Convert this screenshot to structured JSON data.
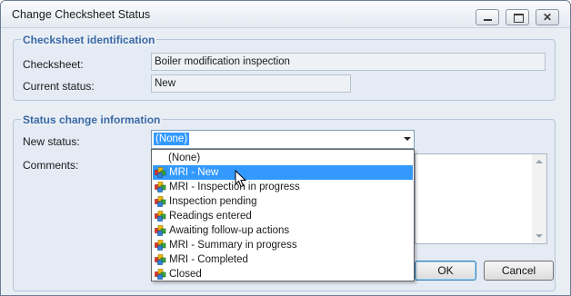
{
  "window": {
    "title": "Change Checksheet Status",
    "controls": {
      "minimize": "—",
      "maximize": "☐",
      "close": "✕"
    }
  },
  "identification": {
    "title": "Checksheet identification",
    "checksheet_label": "Checksheet:",
    "checksheet_value": "Boiler modification inspection",
    "status_label": "Current status:",
    "status_value": "New"
  },
  "change": {
    "title": "Status change information",
    "new_status_label": "New status:",
    "new_status_value": "(None)",
    "comments_label": "Comments:",
    "comments_value": ""
  },
  "dropdown": {
    "selected_index": 1,
    "options": [
      {
        "label": "(None)",
        "icon": "none"
      },
      {
        "label": "MRI - New",
        "icon": "status-cubes-icon"
      },
      {
        "label": "MRI - Inspection in progress",
        "icon": "status-cubes-icon"
      },
      {
        "label": "Inspection pending",
        "icon": "status-cubes-icon"
      },
      {
        "label": "Readings entered",
        "icon": "status-cubes-icon"
      },
      {
        "label": "Awaiting follow-up actions",
        "icon": "status-cubes-icon"
      },
      {
        "label": "MRI - Summary in progress",
        "icon": "status-cubes-icon"
      },
      {
        "label": "MRI - Completed",
        "icon": "status-cubes-icon"
      },
      {
        "label": "Closed",
        "icon": "status-cubes-icon"
      }
    ]
  },
  "buttons": {
    "ok": "OK",
    "cancel": "Cancel"
  },
  "colors": {
    "accent": "#3a6aa6",
    "selection": "#3399ff",
    "window_bg": "#e9eef5"
  }
}
